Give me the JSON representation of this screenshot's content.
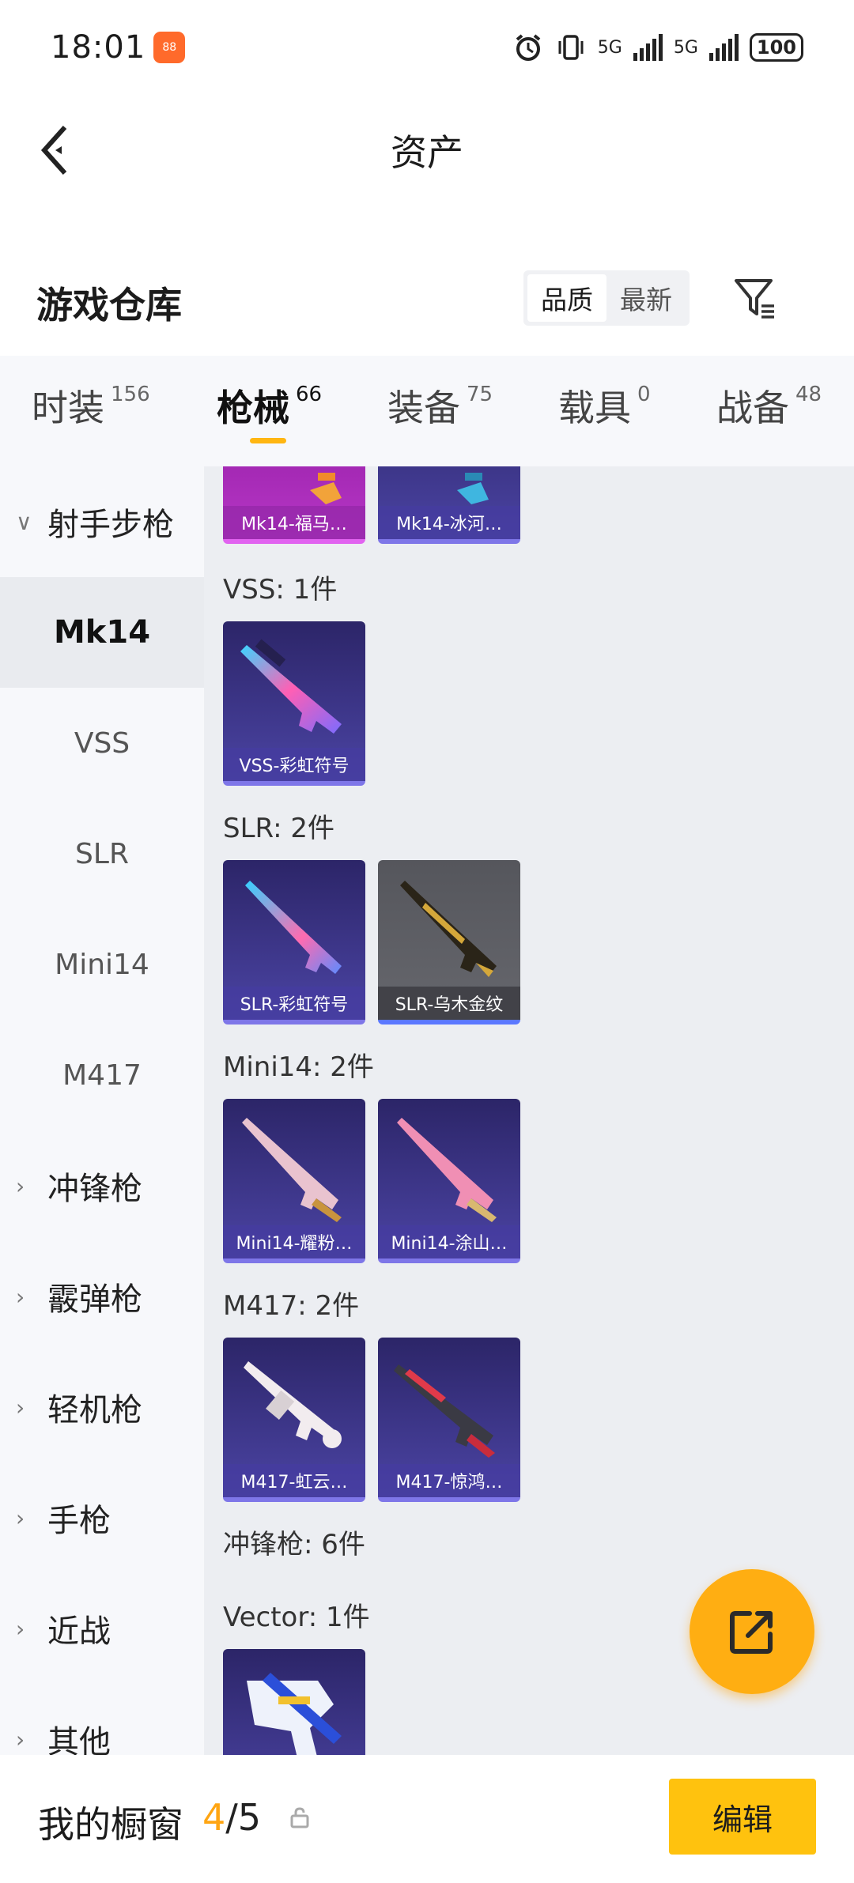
{
  "status_bar": {
    "time": "18:01",
    "app_badge": "88",
    "net1": "5G",
    "net2": "5G",
    "battery": "100"
  },
  "header": {
    "title": "资产"
  },
  "section": {
    "title": "游戏仓库",
    "sort_options": [
      "品质",
      "最新"
    ],
    "active_sort": "品质"
  },
  "tabs": [
    {
      "label": "时装",
      "count": "156"
    },
    {
      "label": "枪械",
      "count": "66"
    },
    {
      "label": "装备",
      "count": "75"
    },
    {
      "label": "载具",
      "count": "0"
    },
    {
      "label": "战备",
      "count": "48"
    }
  ],
  "active_tab": "枪械",
  "sidebar": {
    "items": [
      {
        "label": "射手步枪",
        "kind": "group",
        "chevron": "chevron-down-icon"
      },
      {
        "label": "Mk14",
        "kind": "sub",
        "selected": true
      },
      {
        "label": "VSS",
        "kind": "sub"
      },
      {
        "label": "SLR",
        "kind": "sub"
      },
      {
        "label": "Mini14",
        "kind": "sub"
      },
      {
        "label": "M417",
        "kind": "sub"
      },
      {
        "label": "冲锋枪",
        "kind": "group",
        "chevron": "chevron-right-icon"
      },
      {
        "label": "霰弹枪",
        "kind": "group",
        "chevron": "chevron-right-icon"
      },
      {
        "label": "轻机枪",
        "kind": "group",
        "chevron": "chevron-right-icon"
      },
      {
        "label": "手枪",
        "kind": "group",
        "chevron": "chevron-right-icon"
      },
      {
        "label": "近战",
        "kind": "group",
        "chevron": "chevron-right-icon"
      },
      {
        "label": "其他",
        "kind": "group",
        "chevron": "chevron-right-icon"
      }
    ]
  },
  "content": {
    "mk14_items": [
      "Mk14-福马…",
      "Mk14-冰河…"
    ],
    "groups": [
      {
        "label": "VSS: 1件",
        "items": [
          "VSS-彩虹符号"
        ]
      },
      {
        "label": "SLR: 2件",
        "items": [
          "SLR-彩虹符号",
          "SLR-乌木金纹"
        ]
      },
      {
        "label": "Mini14: 2件",
        "items": [
          "Mini14-耀粉…",
          "Mini14-涂山…"
        ]
      },
      {
        "label": "M417: 2件",
        "items": [
          "M417-虹云…",
          "M417-惊鸿…"
        ]
      },
      {
        "label": "冲锋枪: 6件",
        "items": []
      },
      {
        "label": "Vector: 1件",
        "items": [
          ""
        ]
      }
    ]
  },
  "fab": {
    "icon": "share-icon"
  },
  "bottom_bar": {
    "label": "我的橱窗",
    "count_current": "4",
    "count_sep_total": "/5",
    "edit_label": "编辑"
  },
  "colors": {
    "accent": "#ffb612",
    "fab": "#ffae12",
    "edit_button": "#ffc20e",
    "card_purple": "#3d3689",
    "card_magenta": "#a62ab6",
    "card_gray": "#5f6066"
  }
}
